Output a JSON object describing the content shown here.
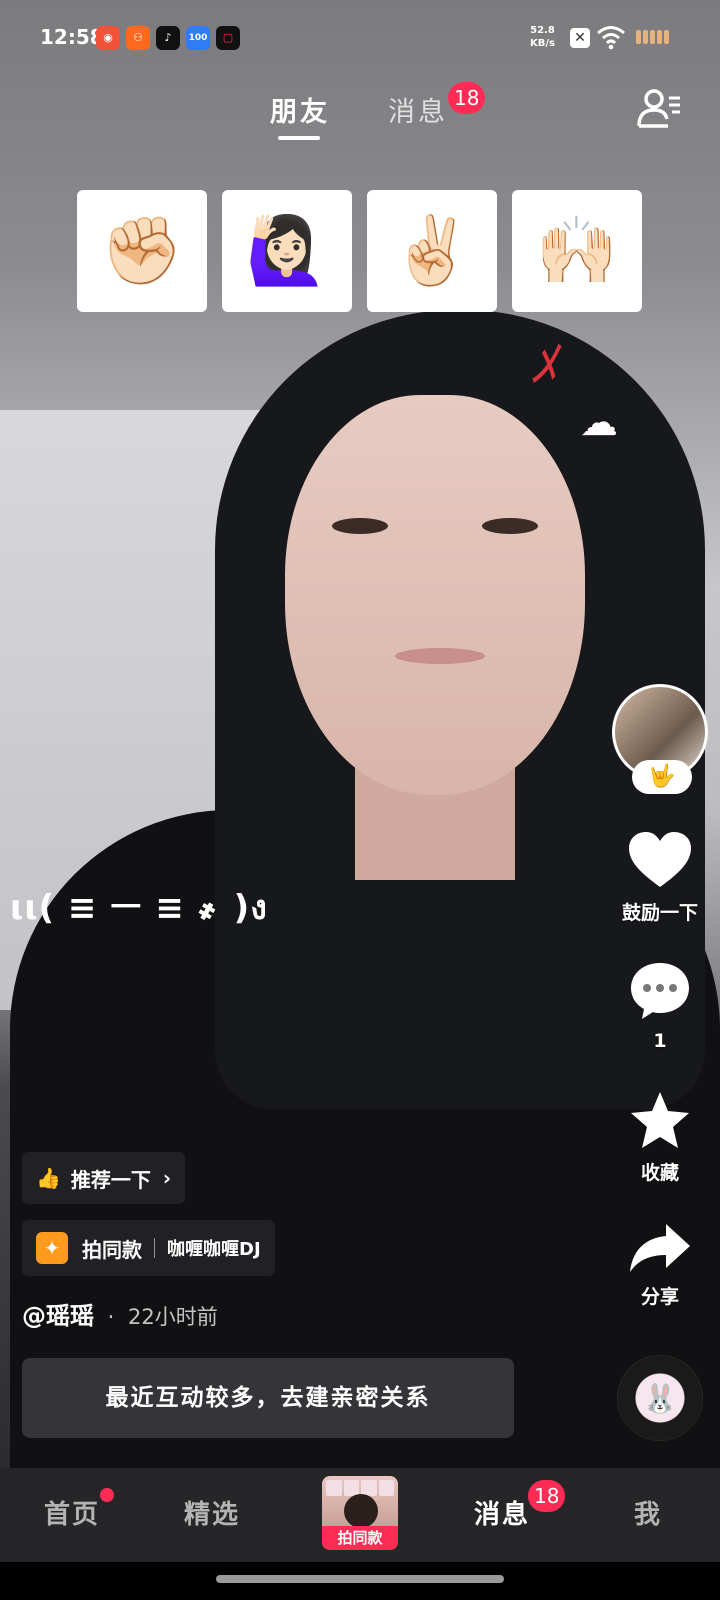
{
  "status_bar": {
    "time": "12:58",
    "net_speed_value": "52.8",
    "net_speed_unit": "KB/s",
    "app_icons": [
      "app-icon-1",
      "app-icon-2",
      "tiktok-icon",
      "app-icon-100",
      "app-icon-video"
    ]
  },
  "top_tabs": {
    "friends": "朋友",
    "messages": "消息",
    "messages_badge": "18"
  },
  "gestures": [
    "✊🏻",
    "🙋🏻‍♀️",
    "✌🏻",
    "🙌🏻"
  ],
  "overlay": {
    "kaomoji": "ιι( ≡ ㅡ ≡ ҂ )ง"
  },
  "actions": {
    "avatar_badge": "🤟",
    "like_label": "鼓励一下",
    "comment_count": "1",
    "favorite_label": "收藏",
    "share_label": "分享"
  },
  "info": {
    "recommend_label": "推荐一下",
    "same_style_label": "拍同款",
    "music_title": "咖喱咖喱DJ",
    "author": "@瑶瑶",
    "separator": "·",
    "time_ago": "22小时前",
    "intimacy_button": "最近互动较多，去建亲密关系"
  },
  "bottom_nav": {
    "home": "首页",
    "featured": "精选",
    "center_label": "拍同款",
    "messages": "消息",
    "messages_badge": "18",
    "me": "我"
  },
  "colors": {
    "accent_red": "#fe2c55",
    "nav_background": "#262628",
    "same_style_orange": "#ff9a1f"
  }
}
